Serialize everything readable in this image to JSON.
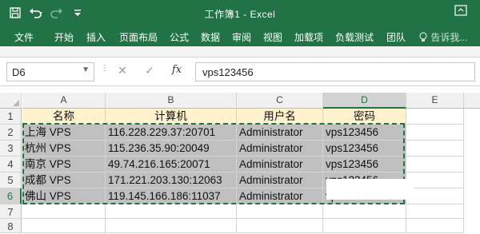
{
  "app": {
    "title": "工作簿1 - Excel"
  },
  "quick_access": {
    "save_icon": "save-icon",
    "undo_icon": "undo-icon",
    "redo_icon": "redo-icon",
    "customize_icon": "customize-icon"
  },
  "menu": [
    "文件",
    "开始",
    "插入",
    "页面布局",
    "公式",
    "数据",
    "审阅",
    "视图",
    "加载项",
    "负载测试",
    "团队"
  ],
  "tell_me": "告诉我...",
  "formula_bar": {
    "name_box": "D6",
    "fx_label": "fx",
    "formula": "vps123456"
  },
  "columns": [
    "A",
    "B",
    "C",
    "D",
    "E"
  ],
  "rows": [
    "1",
    "2",
    "3",
    "4",
    "5",
    "6",
    "7",
    "8"
  ],
  "table": {
    "headers": [
      "名称",
      "计算机",
      "用户名",
      "密码"
    ],
    "data": [
      [
        "上海 VPS",
        "116.228.229.37:20701",
        "Administrator",
        "vps123456"
      ],
      [
        "杭州 VPS",
        "115.236.35.90:20049",
        "Administrator",
        "vps123456"
      ],
      [
        "南京 VPS",
        "49.74.216.165:20071",
        "Administrator",
        "vps123456"
      ],
      [
        "成都 VPS",
        "171.221.203.130:12063",
        "Administrator",
        "vps123456"
      ],
      [
        "佛山 VPS",
        "119.145.166.186:11037",
        "Administrator",
        "vps123456"
      ]
    ]
  },
  "colors": {
    "accent": "#217346",
    "header_fill": "#fff2cc",
    "data_fill": "#c0c0c0"
  }
}
